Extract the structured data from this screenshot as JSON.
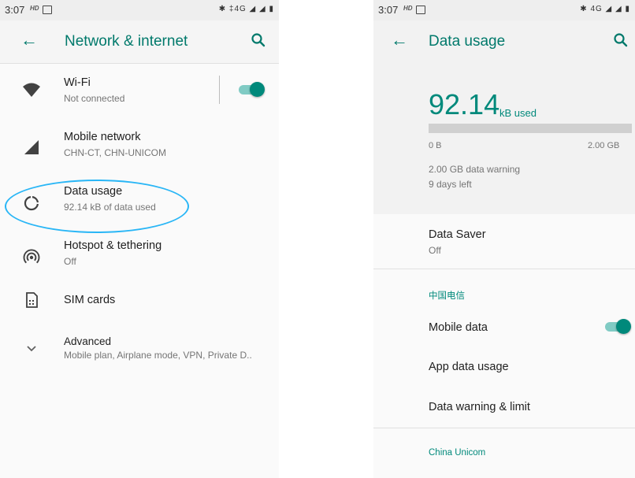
{
  "left": {
    "status": {
      "time": "3:07",
      "hd": "HD",
      "system_icons": "✱ ‡4G ◢ ◢ ▮"
    },
    "appbar": {
      "title": "Network & internet",
      "back_icon": "arrow-back-icon",
      "search_icon": "search-icon"
    },
    "items": [
      {
        "title": "Wi-Fi",
        "subtitle": "Not connected",
        "icon": "wifi-icon",
        "toggle_on": true
      },
      {
        "title": "Mobile network",
        "subtitle": "CHN-CT, CHN-UNICOM",
        "icon": "cell-signal-icon"
      },
      {
        "title": "Data usage",
        "subtitle": "92.14 kB of data used",
        "icon": "data-usage-icon"
      },
      {
        "title": "Hotspot & tethering",
        "subtitle": "Off",
        "icon": "hotspot-icon"
      },
      {
        "title": "SIM cards",
        "subtitle": "",
        "icon": "sim-card-icon"
      },
      {
        "title": "Advanced",
        "subtitle": "Mobile plan, Airplane mode, VPN, Private D..",
        "icon": "chevron-down-icon"
      }
    ]
  },
  "right": {
    "status": {
      "time": "3:07",
      "hd": "HD",
      "system_icons": "✱ 4G ◢ ◢ ▮"
    },
    "appbar": {
      "title": "Data usage",
      "back_icon": "arrow-back-icon",
      "search_icon": "search-icon"
    },
    "summary": {
      "used_value": "92.14",
      "used_unit": "kB used",
      "bar_fraction": 0.0,
      "scale_min": "0 B",
      "scale_max": "2.00 GB",
      "warning": "2.00 GB data warning",
      "days_left": "9 days left"
    },
    "data_saver": {
      "title": "Data Saver",
      "subtitle": "Off"
    },
    "sim1_section": "中国电信",
    "mobile_data": {
      "title": "Mobile data",
      "toggle_on": true
    },
    "app_data_usage": "App data usage",
    "data_warning_limit": "Data warning & limit",
    "sim2_section": "China Unicom"
  },
  "colors": {
    "accent": "#00897b",
    "highlight": "#29b6f6"
  }
}
